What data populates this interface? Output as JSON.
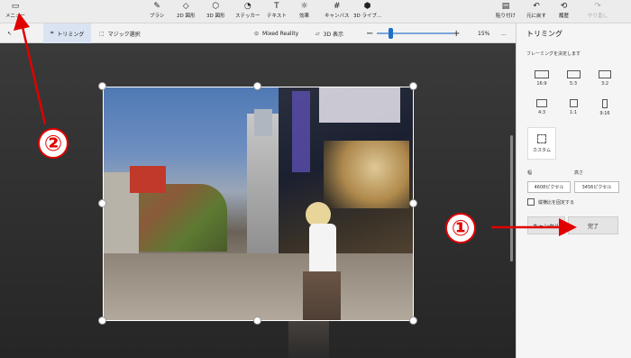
{
  "topbar": {
    "menu_label": "メニュー",
    "tools": [
      {
        "label": "ブラシ",
        "icon": "brush-icon"
      },
      {
        "label": "2D 図形",
        "icon": "2d-shapes-icon"
      },
      {
        "label": "3D 図形",
        "icon": "3d-shapes-icon"
      },
      {
        "label": "ステッカー",
        "icon": "stickers-icon"
      },
      {
        "label": "テキスト",
        "icon": "text-icon"
      },
      {
        "label": "効果",
        "icon": "effects-icon"
      },
      {
        "label": "キャンバス",
        "icon": "canvas-icon"
      },
      {
        "label": "3D ライブ...",
        "icon": "3d-library-icon"
      }
    ],
    "actions": [
      {
        "label": "貼り付け",
        "icon": "paste-icon"
      },
      {
        "label": "元に戻す",
        "icon": "undo-icon"
      },
      {
        "label": "履歴",
        "icon": "history-icon"
      },
      {
        "label": "やり直し",
        "icon": "redo-icon",
        "disabled": true
      }
    ]
  },
  "toolbar2": {
    "crop_label": "トリミング",
    "magic_select_label": "マジック選択",
    "mixed_reality_label": "Mixed Reality",
    "view3d_label": "3D 表示",
    "zoom_value": "15%",
    "zoom_level": 0.18,
    "more": "..."
  },
  "panel": {
    "title": "トリミング",
    "subtitle": "フレーミングを決定します",
    "ratios": [
      "16:9",
      "5:3",
      "3:2",
      "4:3",
      "1:1",
      "9:16"
    ],
    "custom_label": "カスタム",
    "width_label": "幅",
    "height_label": "高さ",
    "width_value": "4608ピクセル",
    "height_value": "3456ピクセル",
    "lock_label": "縦横比を固定する",
    "cancel_label": "キャンセル",
    "done_label": "完了"
  },
  "annotations": {
    "circle1": "①",
    "circle2": "②"
  },
  "colors": {
    "accent": "#1f6fc5",
    "annotation_red": "#e00000"
  }
}
